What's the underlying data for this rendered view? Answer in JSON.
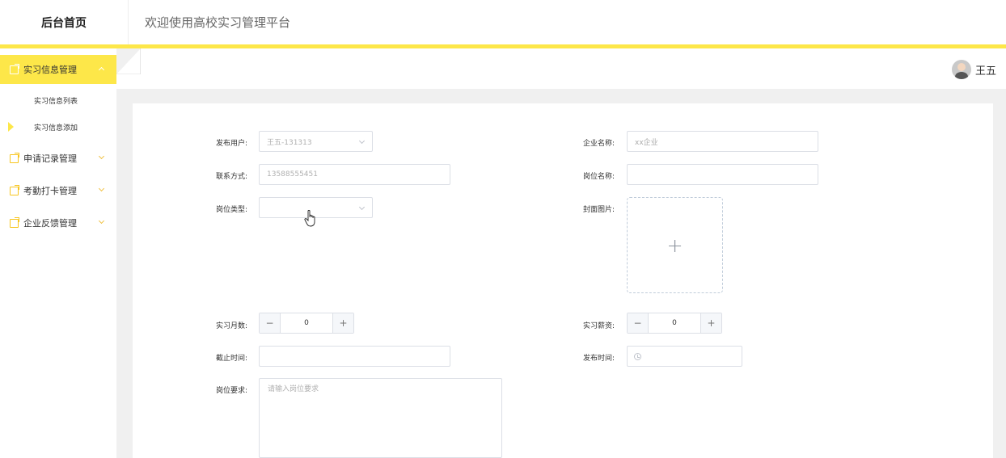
{
  "header": {
    "brand": "后台首页",
    "title": "欢迎使用高校实习管理平台"
  },
  "user": {
    "name": "王五"
  },
  "sidebar": {
    "groups": [
      {
        "label": "实习信息管理",
        "active": true,
        "expanded": true,
        "items": [
          {
            "label": "实习信息列表"
          },
          {
            "label": "实习信息添加",
            "current": true
          }
        ]
      },
      {
        "label": "申请记录管理",
        "active": false,
        "expanded": false
      },
      {
        "label": "考勤打卡管理",
        "active": false,
        "expanded": false
      },
      {
        "label": "企业反馈管理",
        "active": false,
        "expanded": false
      }
    ]
  },
  "form": {
    "publisher": {
      "label": "发布用户:",
      "value": "王五-131313"
    },
    "company": {
      "label": "企业名称:",
      "placeholder": "xx企业"
    },
    "contact": {
      "label": "联系方式:",
      "value": "13588555451"
    },
    "position_name": {
      "label": "岗位名称:",
      "value": ""
    },
    "position_type": {
      "label": "岗位类型:",
      "value": ""
    },
    "cover": {
      "label": "封面图片:",
      "upload_symbol": "+"
    },
    "months": {
      "label": "实习月数:",
      "value": "0",
      "minus": "−",
      "plus": "+"
    },
    "salary": {
      "label": "实习薪资:",
      "value": "0",
      "minus": "−",
      "plus": "+"
    },
    "deadline": {
      "label": "截止时间:",
      "value": ""
    },
    "publish_time": {
      "label": "发布时间:",
      "value": ""
    },
    "requirements": {
      "label": "岗位要求:",
      "placeholder": "请输入岗位要求"
    }
  },
  "colors": {
    "accent": "#fde749",
    "icon": "#f7c51e"
  }
}
